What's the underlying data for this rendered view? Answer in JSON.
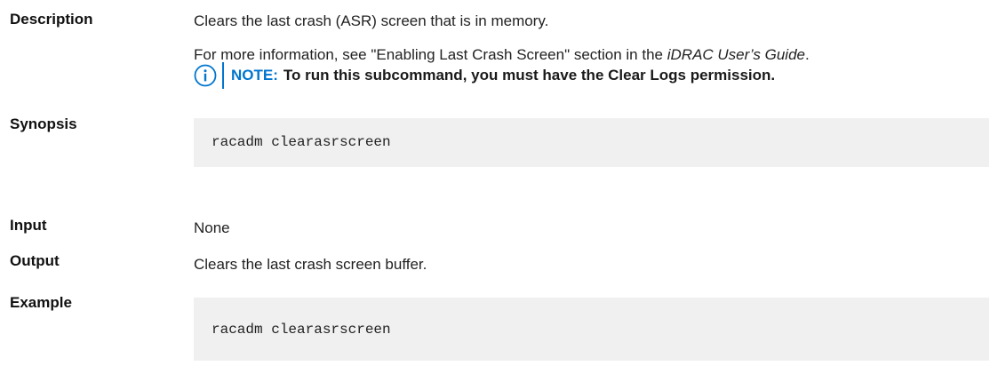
{
  "description": {
    "label": "Description",
    "text": "Clears the last crash (ASR) screen that is in memory.",
    "more_info_prefix": "For more information, see \"Enabling Last Crash Screen\" section in the ",
    "more_info_guide": "iDRAC User’s Guide",
    "more_info_suffix": ".",
    "note_label": "NOTE:",
    "note_text": "To run this subcommand, you must have the Clear Logs permission."
  },
  "synopsis": {
    "label": "Synopsis",
    "code": "racadm clearasrscreen"
  },
  "input": {
    "label": "Input",
    "text": "None"
  },
  "output": {
    "label": "Output",
    "text": "Clears the last crash screen buffer."
  },
  "example": {
    "label": "Example",
    "code": "racadm clearasrscreen"
  },
  "colors": {
    "accent": "#0076ce",
    "code_background": "#f0f0f0"
  },
  "icons": {
    "note": "info-circle-icon"
  }
}
